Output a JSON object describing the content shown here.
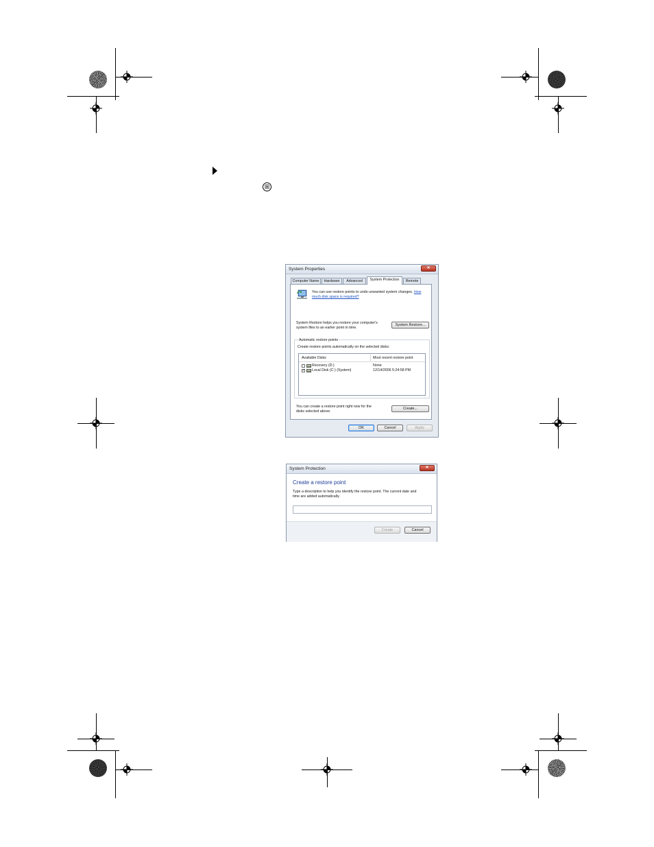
{
  "step": {
    "bullet_icon": "triangle-right-icon",
    "start_icon": "windows-start-icon",
    "start_glyph": "⊞"
  },
  "system_properties": {
    "title": "System Properties",
    "close_glyph": "✕",
    "tabs": [
      "Computer Name",
      "Hardware",
      "Advanced",
      "System Protection",
      "Remote"
    ],
    "active_tab": "System Protection",
    "info_line1": "You can use restore points to undo unwanted system changes.",
    "info_link1": "How",
    "info_link2": "much disk space is required?",
    "restore_text_line1": "System Restore helps you restore your computer's",
    "restore_text_line2": "system files to an earlier point in time.",
    "system_restore_button": "System Restore...",
    "group_title": "Automatic restore points",
    "group_desc": "Create restore points automatically on the selected disks:",
    "columns": [
      "Available Disks",
      "Most recent restore point"
    ],
    "disks": [
      {
        "name": "Recovery (D:)",
        "checked": false,
        "last": "None"
      },
      {
        "name": "Local Disk (C:) (System)",
        "checked": true,
        "last": "12/14/2006 5:24:58 PM"
      }
    ],
    "create_text_line1": "You can create a restore point right now for the",
    "create_text_line2": "disks selected above.",
    "create_button": "Create...",
    "ok_button": "OK",
    "cancel_button": "Cancel",
    "apply_button": "Apply"
  },
  "system_protection": {
    "title": "System Protection",
    "close_glyph": "✕",
    "heading": "Create a restore point",
    "desc_line1": "Type a description to help you identify the restore point. The current date and",
    "desc_line2": "time are added automatically.",
    "input_value": "",
    "create_button": "Create",
    "cancel_button": "Cancel"
  }
}
